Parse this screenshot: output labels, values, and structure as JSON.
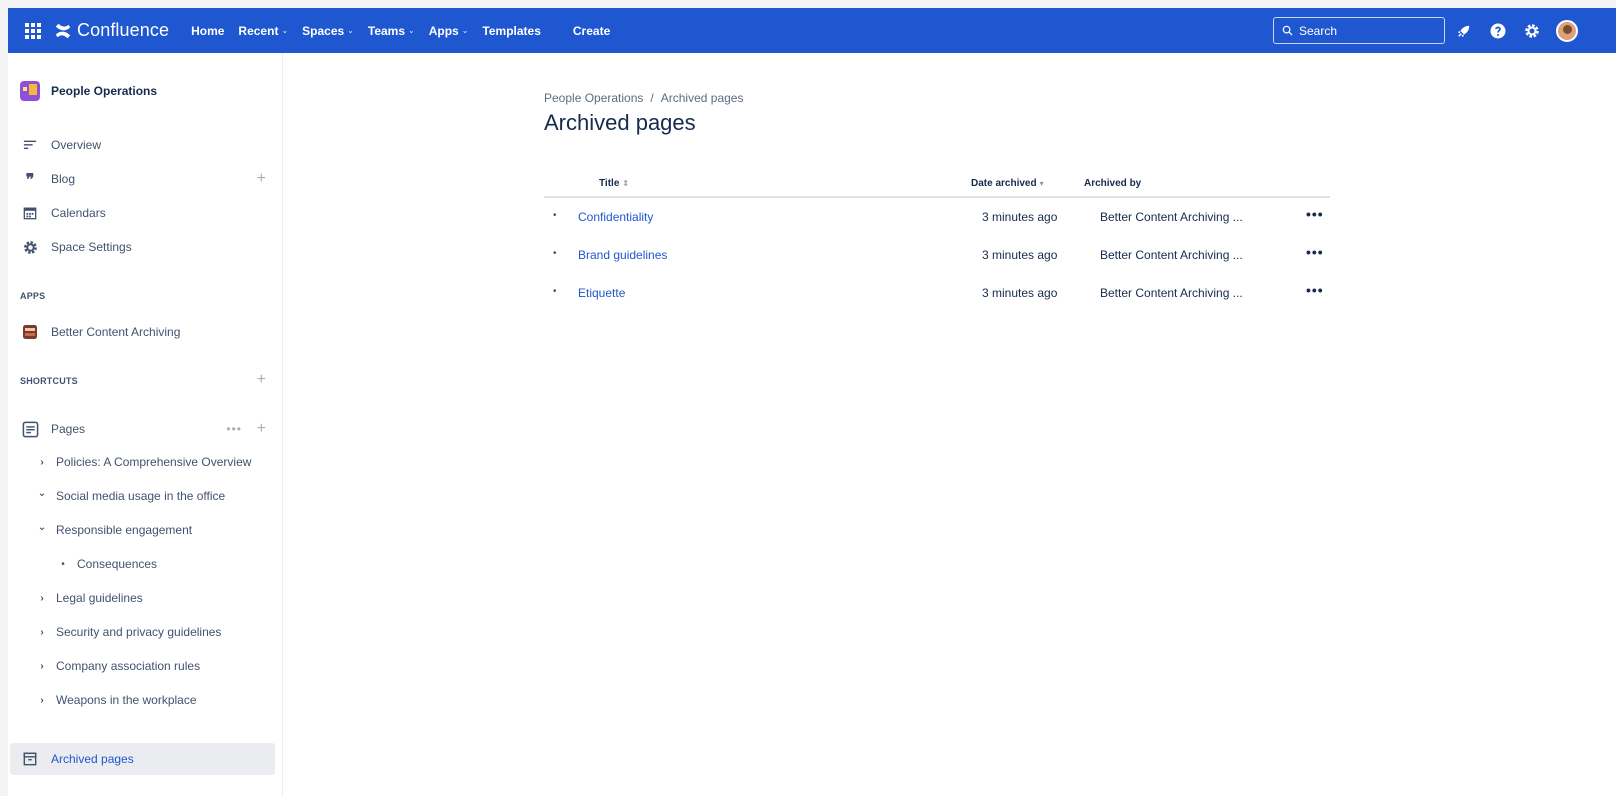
{
  "nav": {
    "logo": "Confluence",
    "items": [
      {
        "label": "Home",
        "chevron": false
      },
      {
        "label": "Recent",
        "chevron": true
      },
      {
        "label": "Spaces",
        "chevron": true
      },
      {
        "label": "Teams",
        "chevron": true
      },
      {
        "label": "Apps",
        "chevron": true
      },
      {
        "label": "Templates",
        "chevron": false
      }
    ],
    "create": "Create",
    "search_placeholder": "Search",
    "icons": [
      "rocket-icon",
      "help-icon",
      "settings-icon",
      "avatar"
    ]
  },
  "sidebar": {
    "space_name": "People Operations",
    "items": {
      "overview": "Overview",
      "blog": "Blog",
      "calendars": "Calendars",
      "space_settings": "Space Settings"
    },
    "apps_heading": "APPS",
    "apps": [
      "Better Content Archiving"
    ],
    "shortcuts_heading": "SHORTCUTS",
    "pages_label": "Pages",
    "tree": [
      {
        "label": "Policies: A Comprehensive Overview",
        "state": "collapsed",
        "depth": 0
      },
      {
        "label": "Social media usage in the office",
        "state": "expanded",
        "depth": 0
      },
      {
        "label": "Responsible engagement",
        "state": "expanded",
        "depth": 1
      },
      {
        "label": "Consequences",
        "state": "leaf",
        "depth": 2
      },
      {
        "label": "Legal guidelines",
        "state": "collapsed",
        "depth": 1
      },
      {
        "label": "Security and privacy guidelines",
        "state": "collapsed",
        "depth": 1
      },
      {
        "label": "Company association rules",
        "state": "collapsed",
        "depth": 1
      },
      {
        "label": "Weapons in the workplace",
        "state": "collapsed",
        "depth": 0
      }
    ],
    "archived_label": "Archived pages"
  },
  "main": {
    "breadcrumb": [
      "People Operations",
      "Archived pages"
    ],
    "breadcrumb_sep": "/",
    "title": "Archived pages",
    "columns": {
      "title": "Title",
      "date_archived": "Date archived",
      "archived_by": "Archived by"
    },
    "rows": [
      {
        "title": "Confidentiality",
        "date": "3 minutes ago",
        "by": "Better Content Archiving ..."
      },
      {
        "title": "Brand guidelines",
        "date": "3 minutes ago",
        "by": "Better Content Archiving ..."
      },
      {
        "title": "Etiquette",
        "date": "3 minutes ago",
        "by": "Better Content Archiving ..."
      }
    ],
    "more_label": "•••"
  },
  "colors": {
    "nav_bg": "#1f57d0",
    "link": "#1f57d0",
    "text": "#172b4d",
    "selected_bg": "#ebecf0"
  }
}
